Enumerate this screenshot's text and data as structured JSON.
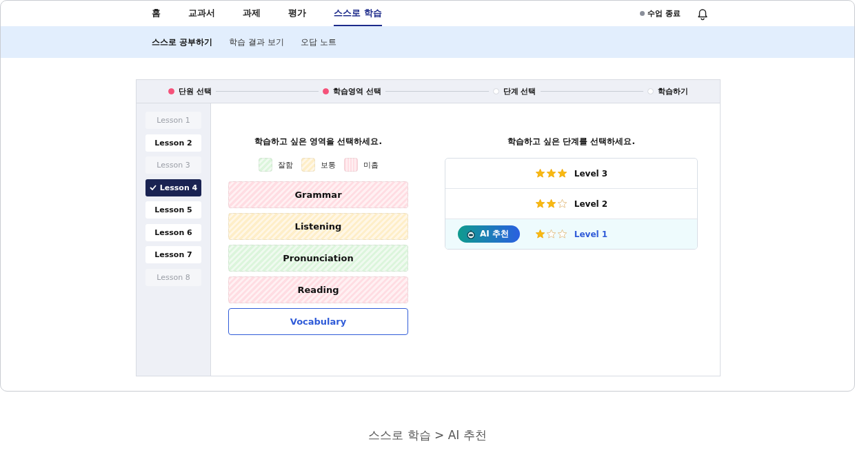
{
  "nav": {
    "tabs": [
      {
        "label": "홈",
        "selected": false
      },
      {
        "label": "교과서",
        "selected": false
      },
      {
        "label": "과제",
        "selected": false
      },
      {
        "label": "평가",
        "selected": false
      },
      {
        "label": "스스로 학습",
        "selected": true
      }
    ],
    "class_status": "수업 종료"
  },
  "subnav": [
    {
      "label": "스스로 공부하기",
      "selected": true
    },
    {
      "label": "학습 결과 보기",
      "selected": false
    },
    {
      "label": "오답 노트",
      "selected": false
    }
  ],
  "steps": [
    {
      "label": "단원 선택",
      "done": true
    },
    {
      "label": "학습영역 선택",
      "done": true
    },
    {
      "label": "단계 선택",
      "done": false
    },
    {
      "label": "학습하기",
      "done": false
    }
  ],
  "lessons": [
    {
      "label": "Lesson 1",
      "disabled": true,
      "selected": false
    },
    {
      "label": "Lesson 2",
      "disabled": false,
      "selected": false
    },
    {
      "label": "Lesson 3",
      "disabled": true,
      "selected": false
    },
    {
      "label": "Lesson 4",
      "disabled": false,
      "selected": true
    },
    {
      "label": "Lesson 5",
      "disabled": false,
      "selected": false
    },
    {
      "label": "Lesson 6",
      "disabled": false,
      "selected": false
    },
    {
      "label": "Lesson 7",
      "disabled": false,
      "selected": false
    },
    {
      "label": "Lesson 8",
      "disabled": true,
      "selected": false
    }
  ],
  "area_panel": {
    "title": "학습하고 싶은 영역을 선택하세요.",
    "legend": [
      {
        "label": "잘함",
        "color": "#dcf5dc"
      },
      {
        "label": "보통",
        "color": "#feeec8"
      },
      {
        "label": "미흡",
        "color": "#ffdde3"
      }
    ],
    "areas": [
      {
        "label": "Grammar",
        "color": "#ffdde3",
        "selected": false
      },
      {
        "label": "Listening",
        "color": "#feeec8",
        "selected": false
      },
      {
        "label": "Pronunciation",
        "color": "#dcf5dc",
        "selected": false
      },
      {
        "label": "Reading",
        "color": "#ffdde3",
        "selected": false
      },
      {
        "label": "Vocabulary",
        "selected": true
      }
    ]
  },
  "level_panel": {
    "title": "학습하고 싶은 단계를 선택하세요.",
    "levels": [
      {
        "label": "Level 3",
        "stars": 3,
        "selected": false
      },
      {
        "label": "Level 2",
        "stars": 2,
        "selected": false
      },
      {
        "label": "Level 1",
        "stars": 1,
        "selected": true,
        "badge": "AI 추천"
      }
    ]
  },
  "caption": "스스로 학습 > AI 추천"
}
